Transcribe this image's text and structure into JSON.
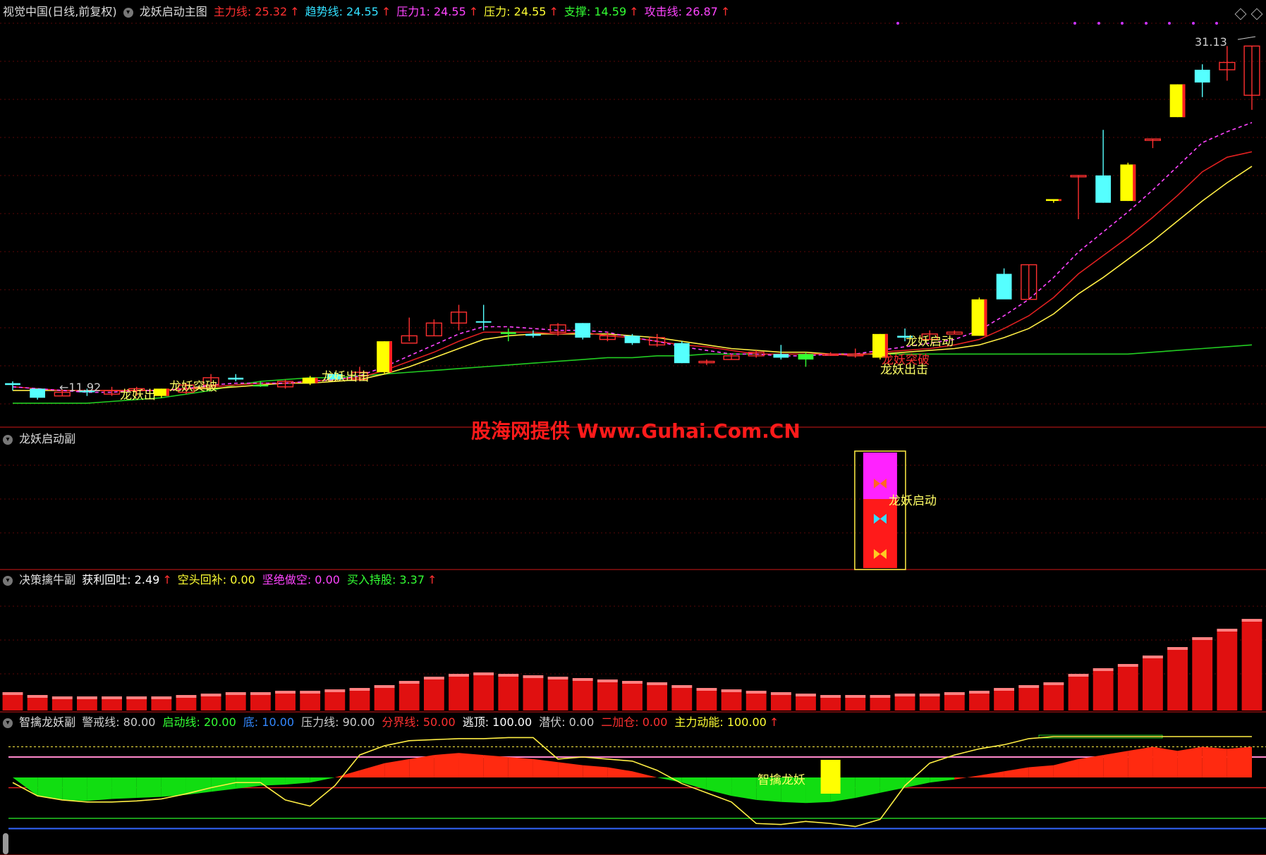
{
  "main": {
    "title": "视觉中国(日线,前复权)",
    "indicator": "龙妖启动主图",
    "metrics": [
      {
        "label": "主力线",
        "value": "25.32",
        "color": "#ff3030",
        "arrow": true
      },
      {
        "label": "趋势线",
        "value": "24.55",
        "color": "#33e0ff",
        "arrow": true
      },
      {
        "label": "压力1",
        "value": "24.55",
        "color": "#ff44ff",
        "arrow": true
      },
      {
        "label": "压力",
        "value": "24.55",
        "color": "#ffff33",
        "arrow": true
      },
      {
        "label": "支撑",
        "value": "14.59",
        "color": "#33ff33",
        "arrow": true
      },
      {
        "label": "攻击线",
        "value": "26.87",
        "color": "#ff44ff",
        "arrow": true
      }
    ],
    "low_label": "←11.92",
    "high_label": "31.13",
    "signals": [
      "龙妖出",
      "龙妖突破",
      "龙妖出击",
      "龙妖启动",
      "龙妖突破",
      "龙妖出击"
    ]
  },
  "watermark": "股海网提供 Www.Guhai.Com.CN",
  "sub1": {
    "title": "龙妖启动副",
    "signal": "龙妖启动"
  },
  "sub2": {
    "title": "决策擒牛副",
    "metrics": [
      {
        "label": "获利回吐",
        "value": "2.49",
        "color": "#ffffff",
        "arrow": true
      },
      {
        "label": "空头回补",
        "value": "0.00",
        "color": "#ffff33",
        "arrow": false
      },
      {
        "label": "坚绝做空",
        "value": "0.00",
        "color": "#ff44ff",
        "arrow": false
      },
      {
        "label": "买入持股",
        "value": "3.37",
        "color": "#33ff33",
        "arrow": true
      }
    ]
  },
  "sub3": {
    "title": "智擒龙妖副",
    "metrics": [
      {
        "label": "警戒线",
        "value": "80.00",
        "color": "#cccccc",
        "arrow": false
      },
      {
        "label": "启动线",
        "value": "20.00",
        "color": "#33ff33",
        "arrow": false
      },
      {
        "label": "底",
        "value": "10.00",
        "color": "#3388ff",
        "arrow": false
      },
      {
        "label": "压力线",
        "value": "90.00",
        "color": "#cccccc",
        "arrow": false
      },
      {
        "label": "分界线",
        "value": "50.00",
        "color": "#ff3030",
        "arrow": false
      },
      {
        "label": "逃顶",
        "value": "100.00",
        "color": "#ffffff",
        "arrow": false
      },
      {
        "label": "潜伏",
        "value": "0.00",
        "color": "#cccccc",
        "arrow": false
      },
      {
        "label": "二加仓",
        "value": "0.00",
        "color": "#ff3030",
        "arrow": false
      },
      {
        "label": "主力动能",
        "value": "100.00",
        "color": "#ffff33",
        "arrow": true
      }
    ],
    "signal": "智擒龙妖"
  },
  "chart_data": {
    "type": "candlestick",
    "candles": [
      [
        12.5,
        12.6,
        12.2,
        12.7,
        "cyan"
      ],
      [
        12.3,
        11.8,
        11.7,
        12.3,
        "cyan"
      ],
      [
        11.9,
        12.1,
        11.9,
        12.2,
        "red"
      ],
      [
        12.2,
        12.1,
        11.9,
        12.3,
        "cyan"
      ],
      [
        12.0,
        12.2,
        11.9,
        12.4,
        "red"
      ],
      [
        12.2,
        12.3,
        11.9,
        12.4,
        "red"
      ],
      [
        12.3,
        11.9,
        11.8,
        12.3,
        "yellow"
      ],
      [
        12.1,
        12.5,
        12.0,
        12.6,
        "red"
      ],
      [
        12.5,
        12.9,
        12.4,
        13.1,
        "red"
      ],
      [
        12.8,
        12.9,
        12.7,
        13.1,
        "cyan"
      ],
      [
        12.5,
        12.5,
        12.4,
        12.7,
        "green"
      ],
      [
        12.4,
        12.7,
        12.3,
        12.8,
        "red"
      ],
      [
        12.9,
        12.6,
        12.5,
        13.0,
        "yellow"
      ],
      [
        12.8,
        13.1,
        12.8,
        13.2,
        "cyan"
      ],
      [
        12.8,
        13.2,
        12.7,
        13.5,
        "red"
      ],
      [
        13.2,
        14.9,
        13.1,
        14.9,
        "yellow"
      ],
      [
        14.8,
        15.2,
        14.9,
        16.2,
        "red"
      ],
      [
        15.2,
        15.9,
        15.2,
        16.1,
        "red"
      ],
      [
        15.9,
        16.5,
        15.5,
        16.9,
        "red"
      ],
      [
        16.0,
        16.0,
        15.5,
        16.9,
        "cyan"
      ],
      [
        15.4,
        15.3,
        14.9,
        15.6,
        "green"
      ],
      [
        15.2,
        15.3,
        15.1,
        15.5,
        "cyan"
      ],
      [
        15.4,
        15.8,
        15.2,
        15.9,
        "red"
      ],
      [
        15.9,
        15.1,
        15.0,
        15.9,
        "cyan"
      ],
      [
        15.0,
        15.2,
        14.9,
        15.4,
        "red"
      ],
      [
        15.2,
        14.8,
        14.7,
        15.3,
        "cyan"
      ],
      [
        14.7,
        15.1,
        14.6,
        15.3,
        "red"
      ],
      [
        14.8,
        13.7,
        13.7,
        14.9,
        "cyan"
      ],
      [
        13.8,
        13.8,
        13.6,
        13.9,
        "red"
      ],
      [
        13.9,
        14.1,
        13.9,
        14.2,
        "red"
      ],
      [
        14.1,
        14.3,
        14.0,
        14.4,
        "red"
      ],
      [
        14.2,
        14.0,
        13.9,
        14.7,
        "cyan"
      ],
      [
        13.9,
        14.2,
        13.5,
        14.3,
        "green"
      ],
      [
        14.2,
        14.2,
        14.1,
        14.3,
        "red"
      ],
      [
        14.2,
        14.1,
        14.0,
        14.5,
        "red"
      ],
      [
        14.0,
        15.3,
        13.9,
        15.3,
        "yellow"
      ],
      [
        15.1,
        15.2,
        14.9,
        15.6,
        "cyan"
      ],
      [
        15.0,
        15.3,
        15.0,
        15.5,
        "red"
      ],
      [
        15.3,
        15.4,
        15.3,
        15.5,
        "red"
      ],
      [
        15.2,
        17.2,
        15.2,
        17.3,
        "yellow"
      ],
      [
        17.2,
        18.6,
        17.3,
        18.9,
        "cyan"
      ],
      [
        17.2,
        19.1,
        17.2,
        19.1,
        "red"
      ],
      [
        22.7,
        22.6,
        22.5,
        22.7,
        "yellow"
      ],
      [
        24.0,
        24.0,
        21.6,
        24.0,
        "red"
      ],
      [
        22.5,
        24.0,
        22.5,
        26.5,
        "cyan"
      ],
      [
        22.6,
        24.6,
        22.6,
        24.7,
        "yellow"
      ],
      [
        26.0,
        26.0,
        25.5,
        26.0,
        "red"
      ],
      [
        27.2,
        29.0,
        27.2,
        29.0,
        "yellow"
      ],
      [
        29.8,
        29.1,
        28.3,
        30.1,
        "cyan"
      ],
      [
        30.2,
        29.8,
        29.2,
        31.1,
        "red"
      ],
      [
        28.4,
        31.1,
        27.6,
        31.1,
        "red"
      ]
    ],
    "lines": {
      "主力线": [
        12.4,
        12.3,
        12.2,
        12.2,
        12.2,
        12.2,
        12.2,
        12.3,
        12.4,
        12.5,
        12.6,
        12.6,
        12.7,
        12.8,
        12.9,
        13.3,
        13.8,
        14.3,
        14.9,
        15.4,
        15.4,
        15.4,
        15.3,
        15.4,
        15.2,
        15.1,
        14.9,
        14.7,
        14.6,
        14.4,
        14.2,
        14.2,
        14.2,
        14.2,
        14.1,
        14.3,
        14.4,
        14.5,
        14.7,
        15.0,
        15.6,
        16.3,
        17.3,
        18.6,
        19.6,
        20.6,
        21.7,
        22.9,
        24.2,
        25.0,
        25.3
      ],
      "趋势线": [
        12.2,
        12.2,
        12.2,
        12.2,
        12.2,
        12.2,
        12.2,
        12.3,
        12.3,
        12.4,
        12.5,
        12.6,
        12.6,
        12.7,
        12.8,
        13.1,
        13.5,
        14.0,
        14.5,
        15.0,
        15.2,
        15.3,
        15.3,
        15.3,
        15.3,
        15.2,
        15.1,
        14.9,
        14.7,
        14.5,
        14.4,
        14.3,
        14.3,
        14.2,
        14.2,
        14.2,
        14.3,
        14.4,
        14.5,
        14.7,
        15.1,
        15.6,
        16.4,
        17.5,
        18.4,
        19.4,
        20.4,
        21.5,
        22.6,
        23.6,
        24.5
      ],
      "攻击线": [
        12.4,
        12.3,
        12.2,
        12.1,
        12.1,
        12.2,
        12.2,
        12.3,
        12.5,
        12.6,
        12.6,
        12.6,
        12.7,
        12.8,
        13.0,
        13.5,
        14.1,
        14.7,
        15.3,
        15.7,
        15.7,
        15.6,
        15.5,
        15.5,
        15.4,
        15.1,
        14.9,
        14.6,
        14.4,
        14.2,
        14.2,
        14.1,
        14.1,
        14.2,
        14.2,
        14.4,
        14.6,
        14.8,
        15.0,
        15.5,
        16.3,
        17.2,
        18.4,
        19.8,
        20.9,
        22.0,
        23.2,
        24.5,
        25.8,
        26.4,
        26.9
      ],
      "支撑": [
        11.5,
        11.5,
        11.5,
        11.5,
        11.6,
        11.7,
        11.8,
        12.0,
        12.2,
        12.5,
        12.7,
        12.8,
        12.9,
        12.9,
        13.0,
        13.1,
        13.2,
        13.3,
        13.4,
        13.5,
        13.6,
        13.7,
        13.8,
        13.9,
        14.0,
        14.0,
        14.1,
        14.1,
        14.2,
        14.2,
        14.2,
        14.2,
        14.2,
        14.2,
        14.2,
        14.2,
        14.2,
        14.2,
        14.2,
        14.2,
        14.2,
        14.2,
        14.2,
        14.2,
        14.2,
        14.2,
        14.3,
        14.4,
        14.5,
        14.6,
        14.7
      ]
    },
    "sub2_bars": [
      1.3,
      1.1,
      1.0,
      1.0,
      1.0,
      1.0,
      1.0,
      1.1,
      1.2,
      1.3,
      1.3,
      1.4,
      1.4,
      1.5,
      1.6,
      1.8,
      2.1,
      2.4,
      2.6,
      2.7,
      2.6,
      2.5,
      2.4,
      2.3,
      2.2,
      2.1,
      2.0,
      1.8,
      1.6,
      1.5,
      1.4,
      1.3,
      1.2,
      1.1,
      1.1,
      1.1,
      1.2,
      1.2,
      1.3,
      1.4,
      1.6,
      1.8,
      2.0,
      2.6,
      3.0,
      3.3,
      3.9,
      4.5,
      5.2,
      5.8,
      6.5
    ],
    "sub3_yellow": [
      55,
      42,
      38,
      36,
      36,
      37,
      39,
      44,
      50,
      55,
      55,
      38,
      32,
      52,
      82,
      91,
      96,
      97,
      98,
      98,
      99,
      99,
      78,
      80,
      78,
      76,
      67,
      54,
      45,
      36,
      15,
      14,
      17,
      15,
      12,
      19,
      52,
      74,
      82,
      88,
      92,
      98,
      100,
      100,
      100,
      100,
      100,
      100,
      100,
      100,
      100
    ],
    "sub3_area": [
      60,
      42,
      38,
      37,
      39,
      40,
      41,
      43,
      46,
      49,
      52,
      53,
      55,
      60,
      67,
      74,
      78,
      82,
      84,
      82,
      80,
      78,
      75,
      72,
      70,
      66,
      60,
      55,
      48,
      42,
      38,
      36,
      35,
      36,
      40,
      45,
      50,
      55,
      58,
      62,
      66,
      70,
      72,
      78,
      82,
      86,
      90,
      86,
      90,
      88,
      90
    ]
  }
}
